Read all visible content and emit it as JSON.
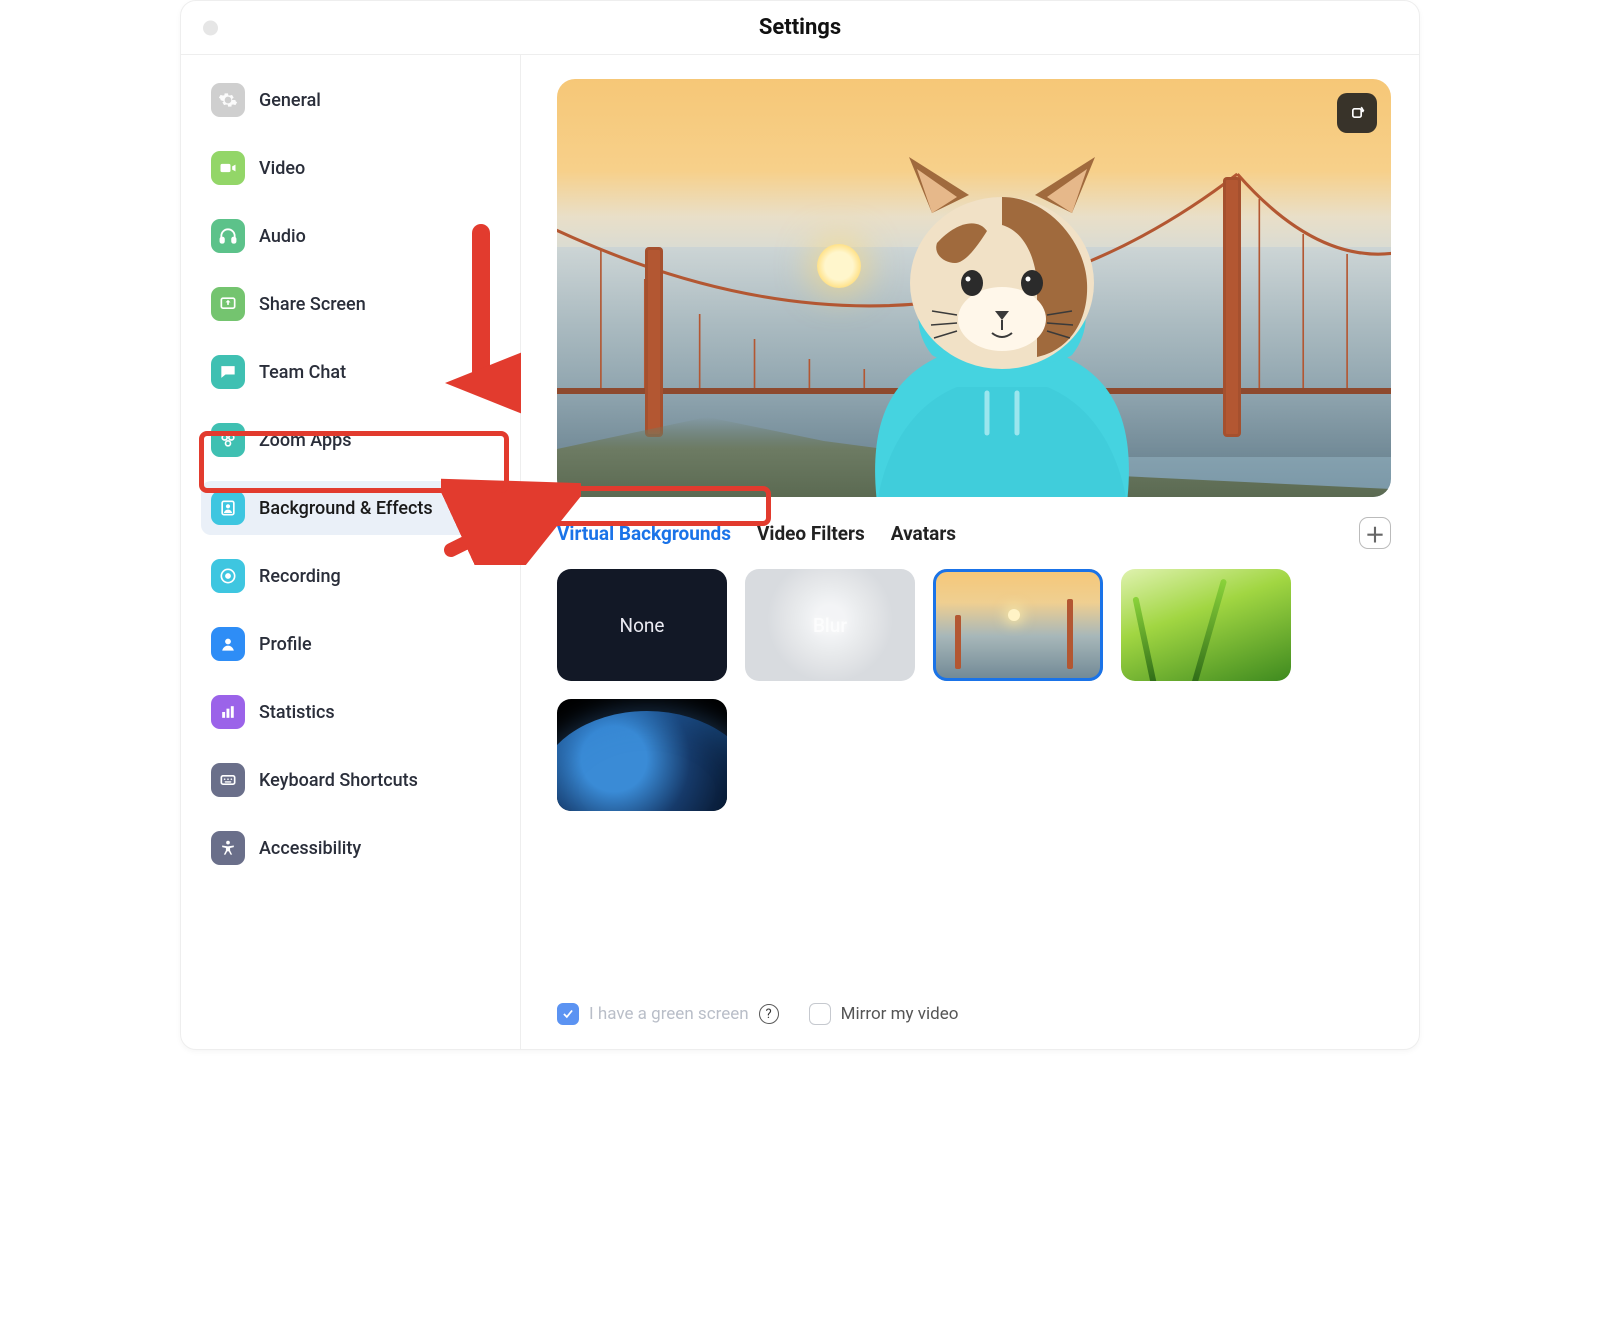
{
  "title": "Settings",
  "sidebar": {
    "items": [
      {
        "label": "General"
      },
      {
        "label": "Video"
      },
      {
        "label": "Audio"
      },
      {
        "label": "Share Screen"
      },
      {
        "label": "Team Chat"
      },
      {
        "label": "Zoom Apps"
      },
      {
        "label": "Background & Effects"
      },
      {
        "label": "Recording"
      },
      {
        "label": "Profile"
      },
      {
        "label": "Statistics"
      },
      {
        "label": "Keyboard Shortcuts"
      },
      {
        "label": "Accessibility"
      }
    ],
    "active_index": 6
  },
  "tabs": {
    "items": [
      "Virtual Backgrounds",
      "Video Filters",
      "Avatars"
    ],
    "active_index": 0
  },
  "thumbs": {
    "none_label": "None",
    "blur_label": "Blur",
    "selected_index": 2
  },
  "footer": {
    "green_screen_label": "I have a green screen",
    "green_screen_checked": true,
    "mirror_label": "Mirror my video",
    "mirror_checked": false
  },
  "colors": {
    "accent": "#1a73e8",
    "annotation": "#e23b2e"
  }
}
